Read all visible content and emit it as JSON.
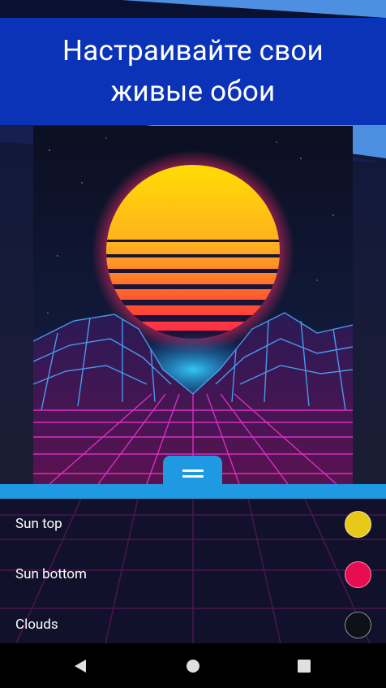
{
  "banner": {
    "title": "Настраивайте свои живые обои"
  },
  "preview": {
    "image": "synthwave-sunset-wallpaper",
    "handle_icon": "drag-handle-icon"
  },
  "settings": [
    {
      "label": "Sun top",
      "color": "#e8c818"
    },
    {
      "label": "Sun bottom",
      "color": "#e80c52"
    },
    {
      "label": "Clouds",
      "color": "#0d1218"
    }
  ],
  "colors": {
    "banner": "#0b33b8",
    "accent": "#1e99e2",
    "grid": "#e030c8"
  },
  "navbar": {
    "back": "back-icon",
    "home": "home-icon",
    "recents": "recents-icon"
  }
}
